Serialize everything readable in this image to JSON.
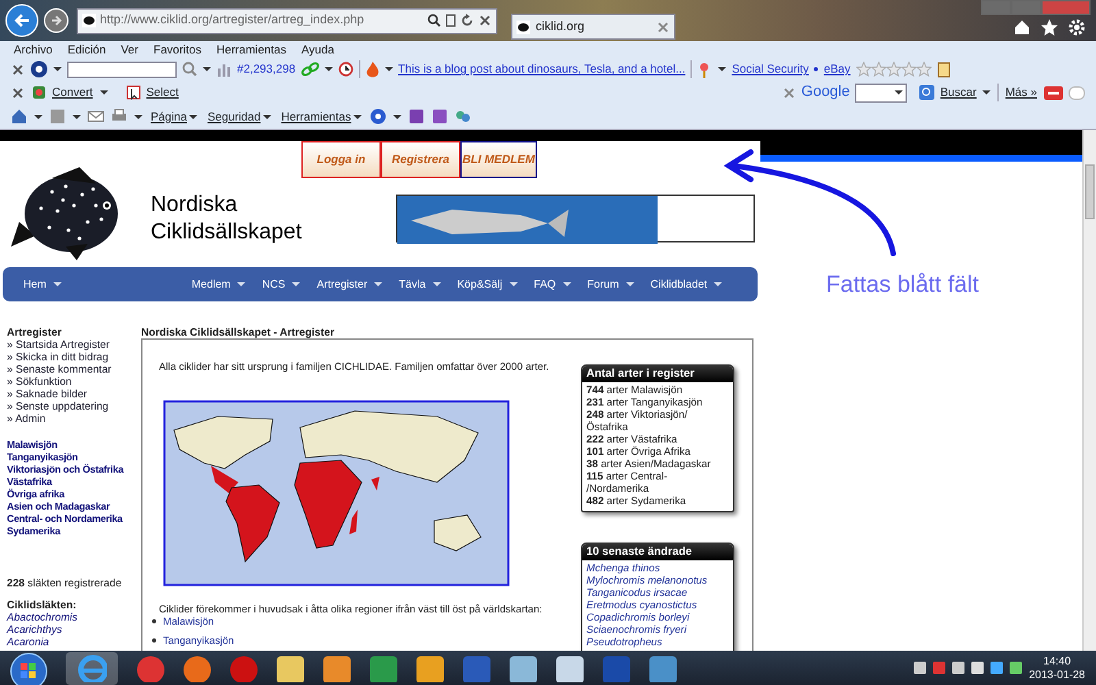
{
  "browser": {
    "address": "http://www.ciklid.org/artregister/artreg_index.php",
    "tab_title": "ciklid.org",
    "menu": [
      "Archivo",
      "Edición",
      "Ver",
      "Favoritos",
      "Herramientas",
      "Ayuda"
    ],
    "toolbar": {
      "counter": "#2,293,298",
      "headline": "This is a blog post about dinosaurs, Tesla, and a hotel...",
      "links": [
        "Social Security",
        "eBay"
      ],
      "stars": 0
    },
    "addon_bar": {
      "convert": "Convert",
      "select": "Select",
      "search_engine": "Google",
      "search_button": "Buscar",
      "more": "Más »"
    },
    "command_bar": [
      "Página",
      "Seguridad",
      "Herramientas"
    ]
  },
  "page": {
    "auth_buttons": [
      {
        "label": "Logga in",
        "highlighted": false
      },
      {
        "label": "Registrera",
        "highlighted": false
      },
      {
        "label": "BLI MEDLEM",
        "highlighted": true
      }
    ],
    "site_title": [
      "Nordiska",
      "Ciklidsällskapet"
    ],
    "nav": {
      "home": "Hem",
      "items": [
        "Medlem",
        "NCS",
        "Artregister",
        "Tävla",
        "Köp&Sälj",
        "FAQ",
        "Forum",
        "Ciklidbladet"
      ]
    },
    "annotation": "Fattas blått fält",
    "sidebar": {
      "heading": "Artregister",
      "links": [
        "» Startsida Artregister",
        "» Skicka in ditt bidrag",
        "» Senaste kommentar",
        "» Sökfunktion",
        "» Saknade bilder",
        "» Senste uppdatering",
        "» Admin"
      ],
      "regions": [
        "Malawisjön",
        "Tanganyikasjön",
        "Viktoriasjön och Östafrika",
        "Västafrika",
        "Övriga afrika",
        "Asien och Madagaskar",
        "Central- och Nordamerika",
        "Sydamerika"
      ],
      "genus_count": "228",
      "genus_count_text": "släkten registrerade",
      "genera_heading": "Ciklidsläkten:",
      "genera": [
        "Abactochromis",
        "Acarichthys",
        "Acaronia"
      ]
    },
    "main": {
      "title": "Nordiska Ciklidsällskapet - Artregister",
      "intro": "Alla ciklider har sitt ursprung i familjen CICHLIDAE. Familjen omfattar över 2000 arter.",
      "regions_text": "Ciklider förekommer i huvudsak i åtta olika regioner ifrån väst till öst på världskartan:",
      "region_links": [
        "Malawisjön",
        "Tanganyikasjön"
      ]
    },
    "species_box": {
      "title": "Antal arter i register",
      "rows": [
        {
          "count": "744",
          "text": "arter Malawisjön"
        },
        {
          "count": "231",
          "text": "arter Tanganyikasjön"
        },
        {
          "count": "248",
          "text": "arter Viktoriasjön/Östafrika"
        },
        {
          "count": "222",
          "text": "arter Västafrika"
        },
        {
          "count": "101",
          "text": "arter Övriga Afrika"
        },
        {
          "count": "38",
          "text": "arter Asien/Madagaskar"
        },
        {
          "count": "115",
          "text": "arter Central- /Nordamerika"
        },
        {
          "count": "482",
          "text": "arter Sydamerika"
        }
      ]
    },
    "recent_box": {
      "title": "10 senaste ändrade",
      "items": [
        "Mchenga thinos",
        "Mylochromis melanonotus",
        "Tanganicodus irsacae",
        "Eretmodus cyanostictus",
        "Copadichromis borleyi",
        "Sciaenochromis fryeri",
        "Pseudotropheus"
      ]
    }
  },
  "taskbar": {
    "time": "14:40",
    "date": "2013-01-28"
  }
}
